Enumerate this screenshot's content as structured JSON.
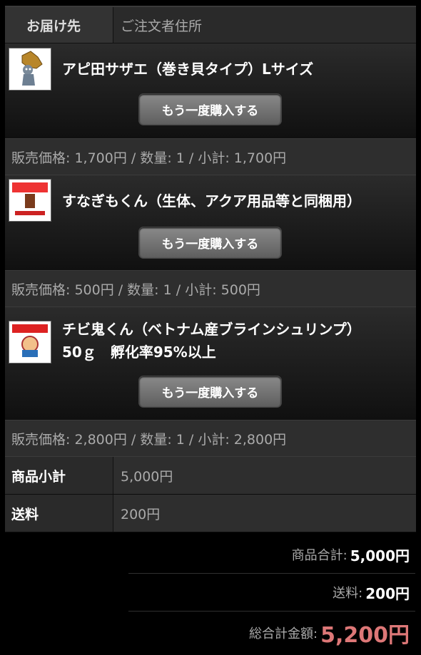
{
  "delivery": {
    "label": "お届け先",
    "value": "ご注文者住所"
  },
  "products": [
    {
      "name": "アピ田サザエ（巻き貝タイプ）Lサイズ",
      "rebuy_label": "もう一度購入する",
      "price_line": "販売価格: 1,700円 / 数量: 1 / 小計: 1,700円"
    },
    {
      "name": "すなぎもくん（生体、アクア用品等と同梱用）",
      "rebuy_label": "もう一度購入する",
      "price_line": "販売価格: 500円 / 数量: 1 / 小計: 500円"
    },
    {
      "name": "チビ鬼くん（ベトナム産ブラインシュリンプ）\n50ｇ　孵化率95%以上",
      "rebuy_label": "もう一度購入する",
      "price_line": "販売価格: 2,800円 / 数量: 1 / 小計: 2,800円"
    }
  ],
  "summary": {
    "subtotal_label": "商品小計",
    "subtotal_value": "5,000円",
    "shipping_label": "送料",
    "shipping_value": "200円"
  },
  "totals": {
    "goods_label": "商品合計:",
    "goods_value": "5,000円",
    "shipping_label": "送料:",
    "shipping_value": "200円",
    "grand_label": "総合計金額:",
    "grand_value": "5,200円"
  },
  "colors": {
    "accent_total": "#dd7777",
    "button": "#707070"
  }
}
